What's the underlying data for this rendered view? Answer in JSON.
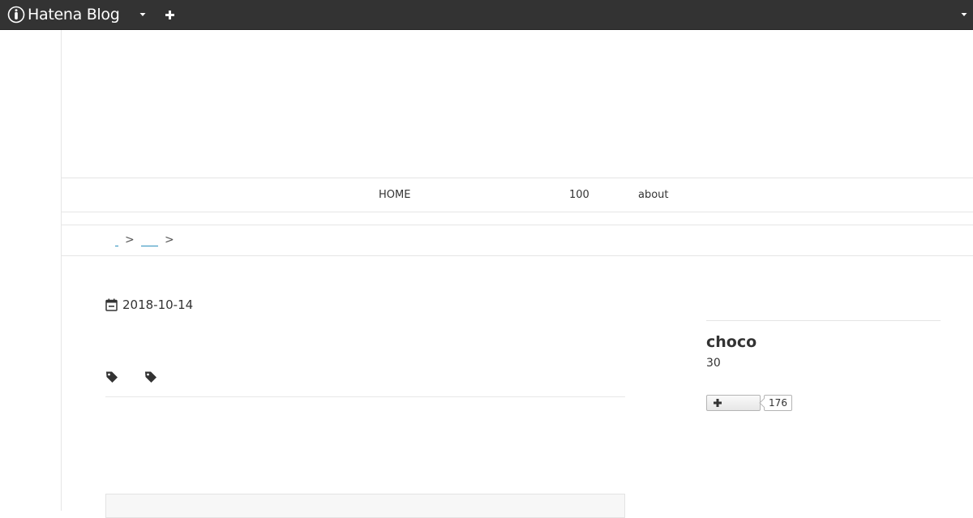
{
  "topbar": {
    "logo_text": "Hatena Blog",
    "logo_icon": "hatena-blog-logo-icon",
    "caret_icon": "caret-down-icon",
    "add_icon": "plus-icon",
    "background_color": "#333333"
  },
  "nav": {
    "items": [
      {
        "label": "HOME"
      },
      {
        "label": "100"
      },
      {
        "label": "about"
      }
    ]
  },
  "breadcrumb": {
    "separator": ">",
    "link_color": "#2a8fbd"
  },
  "article": {
    "date": "2018-10-14",
    "date_icon": "calendar-icon",
    "tag_icon": "tag-icon"
  },
  "sidebar": {
    "profile_name": "choco",
    "profile_count": "30",
    "follow_icon": "plus-icon",
    "follow_count": "176"
  }
}
